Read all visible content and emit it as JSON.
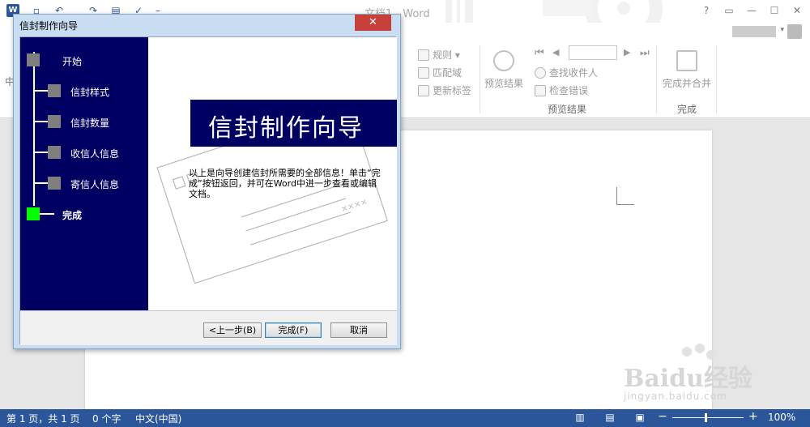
{
  "titlebar": {
    "app_logo": "W",
    "document_title": "文档1 - Word",
    "qat_icons": [
      "save-icon",
      "undo-icon",
      "redo-icon",
      "print-preview-icon",
      "spelling-icon",
      "customize-icon"
    ],
    "window_buttons": [
      "?",
      "▭",
      "—",
      "☐",
      "✕"
    ]
  },
  "ribbon": {
    "rules_label": "规则 ▾",
    "match_fields_label": "匹配域",
    "update_labels_label": "更新标签",
    "preview_results_button": "预览结果",
    "find_recipient_label": "查找收件人",
    "check_errors_label": "检查错误",
    "preview_group_label": "预览结果",
    "finish_merge_button": "完成并合并",
    "finish_group_label": "完成",
    "left_edge_text": "中",
    "nav_first": "⏮",
    "nav_prev": "◀",
    "nav_next": "▶",
    "nav_last": "⏭"
  },
  "wizard": {
    "title": "信封制作向导",
    "close_label": "✕",
    "steps": [
      {
        "label": "开始",
        "state": "pending"
      },
      {
        "label": "信封样式",
        "state": "pending"
      },
      {
        "label": "信封数量",
        "state": "pending"
      },
      {
        "label": "收信人信息",
        "state": "pending"
      },
      {
        "label": "寄信人信息",
        "state": "pending"
      },
      {
        "label": "完成",
        "state": "current"
      }
    ],
    "banner_title": "信封制作向导",
    "description": "以上是向导创建信封所需要的全部信息！单击“完成”按钮返回，并可在Word中进一步查看或编辑文档。",
    "envelope_stamp_text": "××××",
    "buttons": {
      "back": "<上一步(B)",
      "finish": "完成(F)",
      "cancel": "取消"
    },
    "colors": {
      "panel": "#000063",
      "step_pending": "#7f7f7f",
      "step_current": "#00ff00"
    }
  },
  "statusbar": {
    "page_info": "第 1 页，共 1 页",
    "word_count": "0 个字",
    "language": "中文(中国)",
    "zoom_level": "100%",
    "zoom_minus": "−",
    "zoom_plus": "+",
    "view_icons": [
      "read-mode-icon",
      "print-layout-icon",
      "web-layout-icon"
    ]
  },
  "watermark": {
    "brand": "Baidu经验",
    "url": "jingyan.baidu.com"
  }
}
